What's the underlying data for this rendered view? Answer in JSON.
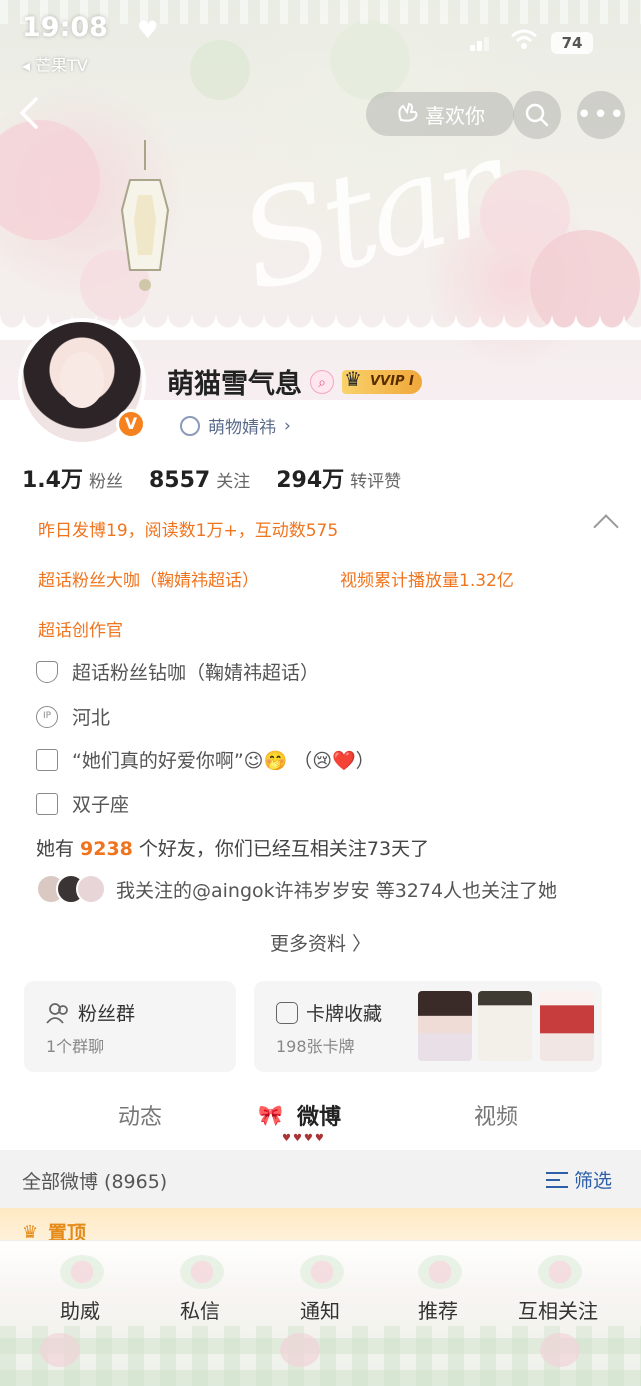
{
  "status_bar": {
    "time": "19:08",
    "back_app": "◂ 芒果TV",
    "battery": "74"
  },
  "nav": {
    "like_label": "喜欢你"
  },
  "profile": {
    "name": "萌猫雪气息",
    "vip_label": "VVIP I",
    "tag": "萌物婧祎",
    "stats": [
      {
        "value": "1.4万",
        "label": "粉丝"
      },
      {
        "value": "8557",
        "label": "关注"
      },
      {
        "value": "294万",
        "label": "转评赞"
      }
    ],
    "highlights": [
      "昨日发博19，阅读数1万+，互动数575",
      "超话粉丝大咖（鞠婧祎超话）",
      "视频累计播放量1.32亿",
      "超话创作官"
    ],
    "info": {
      "badge": "超话粉丝钻咖（鞠婧祎超话）",
      "ip": "河北",
      "bio": "“她们真的好爱你啊”😉🤭 （😢❤️）",
      "zodiac": "双子座"
    },
    "friends_prefix": "她有",
    "friends_count": "9238",
    "friends_suffix": "个好友，你们已经互相关注73天了",
    "mutual_text": "我关注的@aingok许祎岁岁安  等3274人也关注了她",
    "more_info": "更多资料 〉"
  },
  "cards": {
    "fans_group": {
      "title": "粉丝群",
      "sub": "1个群聊"
    },
    "card_collection": {
      "title": "卡牌收藏",
      "sub": "198张卡牌"
    }
  },
  "tabs": [
    "动态",
    "微博",
    "视频"
  ],
  "filter": {
    "title": "全部微博 (8965)",
    "button": "筛选"
  },
  "pinned_label": "置顶",
  "bottom_bar": [
    "助威",
    "私信",
    "通知",
    "推荐",
    "互相关注"
  ],
  "colors": {
    "accent_orange": "#f0741d",
    "link_blue": "#2d5fa8"
  }
}
